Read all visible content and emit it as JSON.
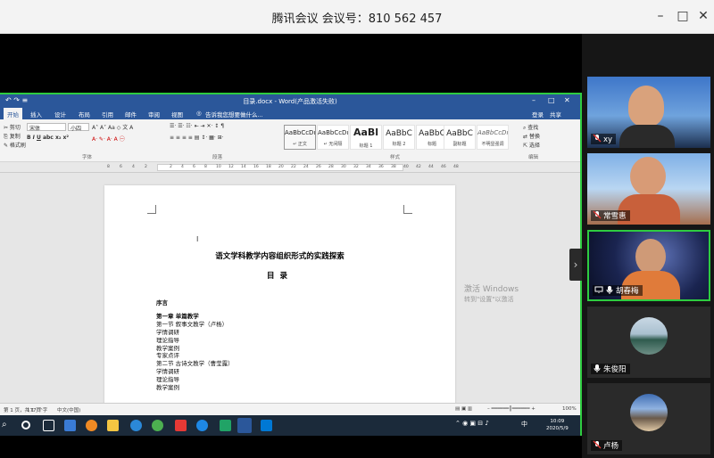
{
  "meeting": {
    "title": "腾讯会议 会议号：810 562 457",
    "minimize": "–",
    "maximize": "□",
    "close": "✕"
  },
  "word": {
    "window_title": "目录.docx - Word(产品激活失败)",
    "tabs": [
      "开始",
      "插入",
      "设计",
      "布局",
      "引用",
      "邮件",
      "审阅",
      "视图"
    ],
    "tell_me": "告诉我您想要做什么...",
    "share": "共享",
    "signin": "登录",
    "font_name": "宋体",
    "font_size": "小四",
    "groups": [
      "字体",
      "段落",
      "样式",
      "编辑"
    ],
    "styles": [
      {
        "preview": "AaBbCcDı",
        "name": "↵ 正文"
      },
      {
        "preview": "AaBbCcDı",
        "name": "↵ 无间隔"
      },
      {
        "preview": "AaBl",
        "name": "标题 1"
      },
      {
        "preview": "AaBbC",
        "name": "标题 2"
      },
      {
        "preview": "AaBbC",
        "name": "标题"
      },
      {
        "preview": "AaBbC",
        "name": "副标题"
      },
      {
        "preview": "AaBbCcDı",
        "name": "不明显强调"
      }
    ],
    "edit_items": [
      "查找",
      "替换",
      "选择"
    ],
    "ruler_marks": [
      "8",
      "6",
      "4",
      "2",
      "2",
      "4",
      "6",
      "8",
      "10",
      "12",
      "14",
      "16",
      "18",
      "20",
      "22",
      "24",
      "26",
      "28",
      "30",
      "32",
      "34",
      "36",
      "38",
      "40",
      "42",
      "44",
      "46",
      "48"
    ],
    "doc": {
      "title": "语文学科教学内容组织形式的实践探索",
      "subtitle": "目录",
      "toc": [
        "序言",
        "第一章  单篇教学",
        "第一节  叙事文教学（卢杨）",
        "学情调研",
        "理论指导",
        "教学案例",
        "专家点评",
        "第二节  古诗文教学（曹莹露）",
        "学情调研",
        "理论指导",
        "教学案例"
      ]
    },
    "status": {
      "page": "第 1 页，共 1 页",
      "words": "177 个字",
      "lang": "中文(中国)",
      "zoom": "100%"
    }
  },
  "watermark": {
    "line1": "激活 Windows",
    "line2": "转到\"设置\"以激活"
  },
  "taskbar": {
    "time": "10:09",
    "date": "2020/5/9",
    "ime": "中"
  },
  "participants": [
    {
      "name": "xy",
      "muted": true
    },
    {
      "name": "常雪惠",
      "muted": true
    },
    {
      "name": "胡春梅",
      "muted": false,
      "sharing": true
    },
    {
      "name": "朱俊阳",
      "muted": false
    },
    {
      "name": "卢杨",
      "muted": true
    }
  ],
  "colors": {
    "word_blue": "#2b579a",
    "share_green": "#2ecc40",
    "meeting_bg": "#161616"
  }
}
